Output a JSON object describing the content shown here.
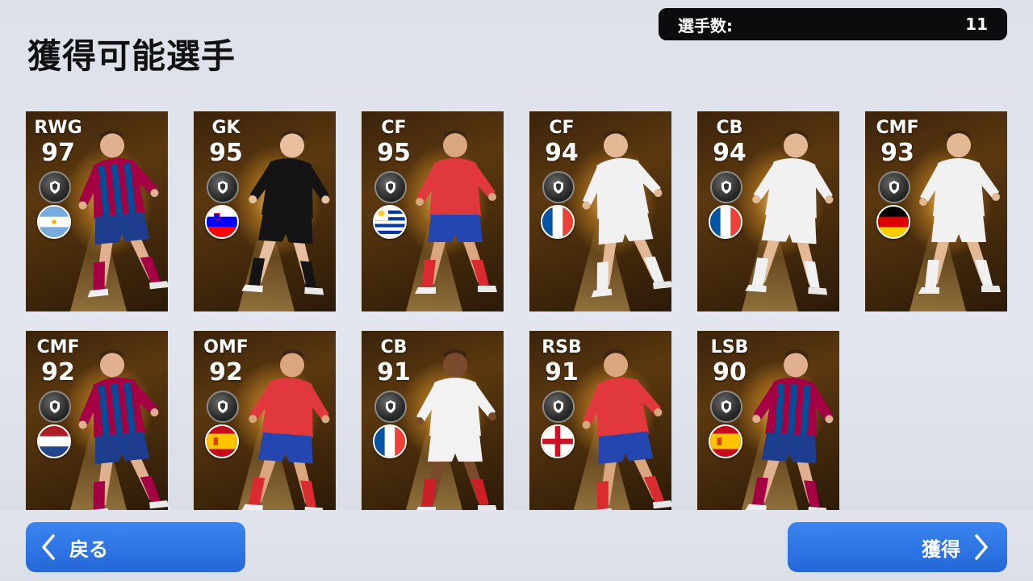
{
  "header": {
    "title": "獲得可能選手"
  },
  "count": {
    "label": "選手数:",
    "value": "11"
  },
  "cards": [
    {
      "position": "RWG",
      "rating": "97",
      "flag": "argentina",
      "kit": "barcelona"
    },
    {
      "position": "GK",
      "rating": "95",
      "flag": "slovenia",
      "kit": "keeper-black"
    },
    {
      "position": "CF",
      "rating": "95",
      "flag": "uruguay",
      "kit": "atletico"
    },
    {
      "position": "CF",
      "rating": "94",
      "flag": "france",
      "kit": "white"
    },
    {
      "position": "CB",
      "rating": "94",
      "flag": "france",
      "kit": "white"
    },
    {
      "position": "CMF",
      "rating": "93",
      "flag": "germany",
      "kit": "white"
    },
    {
      "position": "CMF",
      "rating": "92",
      "flag": "netherlands",
      "kit": "barcelona"
    },
    {
      "position": "OMF",
      "rating": "92",
      "flag": "spain",
      "kit": "atletico"
    },
    {
      "position": "CB",
      "rating": "91",
      "flag": "france",
      "kit": "sevilla-white"
    },
    {
      "position": "RSB",
      "rating": "91",
      "flag": "england",
      "kit": "atletico"
    },
    {
      "position": "LSB",
      "rating": "90",
      "flag": "spain",
      "kit": "barcelona"
    }
  ],
  "footer": {
    "back_label": "戻る",
    "get_label": "獲得"
  },
  "icons": {
    "back": "chevron-left-icon",
    "forward": "chevron-right-icon",
    "badge": "club-badge-icon"
  },
  "colors": {
    "button": "#2f7ae5",
    "count_bar": "#0c0c0e",
    "card_gold": "#5b380f"
  }
}
